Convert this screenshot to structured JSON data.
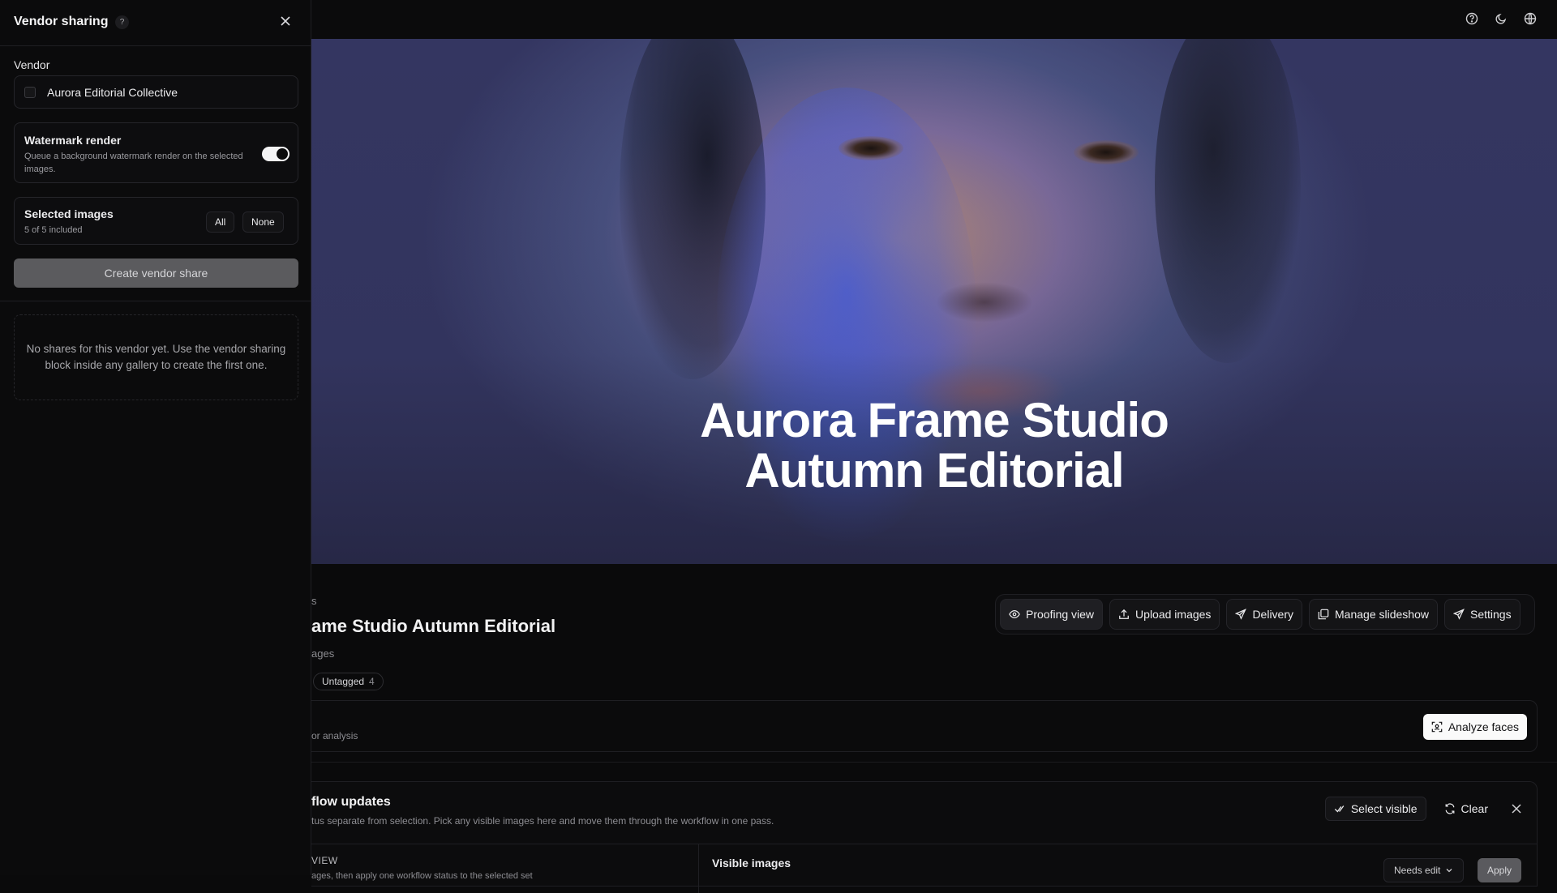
{
  "top_icons": [
    {
      "name": "help-circle-icon",
      "glyph": "?"
    },
    {
      "name": "moon-icon",
      "glyph": "☾"
    },
    {
      "name": "globe-icon",
      "glyph": "◍"
    }
  ],
  "hero": {
    "title_line1": "Aurora Frame Studio",
    "title_line2": "Autumn Editorial"
  },
  "gallery": {
    "breadcrumb": "s",
    "title": "ame Studio Autumn Editorial",
    "count": "ages",
    "tag": {
      "label": "Untagged",
      "count": "4"
    }
  },
  "actions": {
    "proofing": "Proofing view",
    "upload": "Upload images",
    "delivery": "Delivery",
    "slideshow": "Manage slideshow",
    "settings": "Settings"
  },
  "faces": {
    "subtitle": "or analysis",
    "analyze_label": "Analyze faces"
  },
  "workflow": {
    "title": "flow updates",
    "subtitle": "tus separate from selection. Pick any visible images here and move them through the workflow in one pass.",
    "select_visible": "Select visible",
    "clear": "Clear",
    "left_heading": "VIEW",
    "left_sub": "ages, then apply one workflow status to the selected set",
    "visible_images": "Visible images",
    "status_select": "Needs edit",
    "apply": "Apply"
  },
  "panel": {
    "title": "Vendor sharing",
    "help": "?",
    "vendor_label": "Vendor",
    "vendor_value": "Aurora Editorial Collective",
    "watermark_title": "Watermark render",
    "watermark_desc": "Queue a background watermark render on the selected images.",
    "watermark_enabled": true,
    "selected_title": "Selected images",
    "selected_count": "5 of 5 included",
    "all_label": "All",
    "none_label": "None",
    "create_label": "Create vendor share",
    "empty_message": "No shares for this vendor yet. Use the vendor sharing block inside any gallery to create the first one."
  }
}
